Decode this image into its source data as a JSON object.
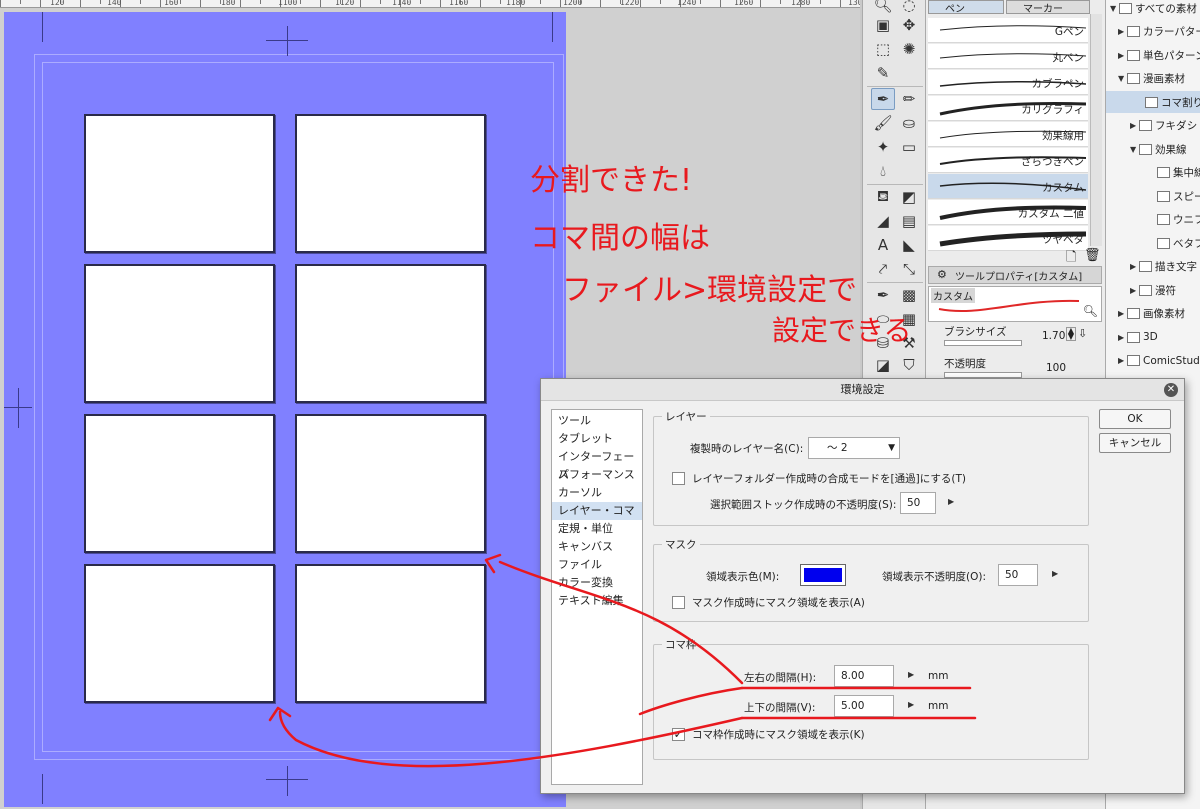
{
  "ruler": {
    "labels": [
      "120",
      "140",
      "160",
      "180",
      "1100",
      "1120",
      "1140",
      "1160",
      "1180",
      "1200",
      "1220",
      "1240",
      "1260",
      "1280",
      "1300"
    ]
  },
  "subtool": {
    "tab_pen": "ペン",
    "tab_marker": "マーカー",
    "brushes": [
      "Gペン",
      "丸ペン",
      "カブラペン",
      "カリグラフィ",
      "効果線用",
      "ざらつきペン",
      "カスタム",
      "カスタム 二値",
      "ツヤベタ"
    ],
    "selected_brush": "カスタム",
    "tool_property_title": "ツールプロパティ[カスタム]",
    "preview_name": "カスタム",
    "brush_size_label": "ブラシサイズ",
    "brush_size_value": "1.70",
    "opacity_label": "不透明度",
    "opacity_value": "100",
    "stroke_color": "#e02828"
  },
  "tree": [
    {
      "label": "すべての素材",
      "arrow": "▼"
    },
    {
      "label": "カラーパターン",
      "arrow": "▶"
    },
    {
      "label": "単色パターン",
      "arrow": "▶"
    },
    {
      "label": "漫画素材",
      "arrow": "▼"
    },
    {
      "label": "コマ割りテンプレート",
      "arrow": ""
    },
    {
      "label": "フキダシ",
      "arrow": "▶"
    },
    {
      "label": "効果線",
      "arrow": "▼"
    },
    {
      "label": "集中線",
      "arrow": ""
    },
    {
      "label": "スピード線",
      "arrow": ""
    },
    {
      "label": "ウニフラッシュ",
      "arrow": ""
    },
    {
      "label": "ベタフラッシュ",
      "arrow": ""
    },
    {
      "label": "描き文字",
      "arrow": "▶"
    },
    {
      "label": "漫符",
      "arrow": "▶"
    },
    {
      "label": "画像素材",
      "arrow": "▶"
    },
    {
      "label": "3D",
      "arrow": "▶"
    },
    {
      "label": "ComicStudio",
      "arrow": "▶"
    }
  ],
  "dialog": {
    "title": "環境設定",
    "categories": [
      "ツール",
      "タブレット",
      "インターフェース",
      "パフォーマンス",
      "カーソル",
      "レイヤー・コマ",
      "定規・単位",
      "キャンバス",
      "ファイル",
      "カラー変換",
      "テキスト編集"
    ],
    "selected_category": "レイヤー・コマ",
    "ok": "OK",
    "cancel": "キャンセル",
    "layer": {
      "group_label": "レイヤー",
      "dup_name_label": "複製時のレイヤー名(C):",
      "dup_name_value": "～ 2",
      "folder_blend_label": "レイヤーフォルダー作成時の合成モードを[通過]にする(T)",
      "stock_opacity_label": "選択範囲ストック作成時の不透明度(S):",
      "stock_opacity_value": "50"
    },
    "mask": {
      "group_label": "マスク",
      "area_color_label": "領域表示色(M):",
      "area_color": "#0000ee",
      "area_opacity_label": "領域表示不透明度(O):",
      "area_opacity_value": "50",
      "show_on_create_label": "マスク作成時にマスク領域を表示(A)"
    },
    "frame": {
      "group_label": "コマ枠",
      "h_gap_label": "左右の間隔(H):",
      "h_gap_value": "8.00",
      "v_gap_label": "上下の間隔(V):",
      "v_gap_value": "5.00",
      "unit": "mm",
      "show_mask_label": "コマ枠作成時にマスク領域を表示(K)",
      "show_mask_checked": "✓"
    }
  },
  "annotation": {
    "line1": "分割できた!",
    "line2": "コマ間の幅は",
    "line3": "ファイル>環境設定で",
    "line4": "設定できる",
    "color": "#e8191e"
  },
  "colors": {
    "page": "#8080ff",
    "selection": "#c9d9eb"
  }
}
